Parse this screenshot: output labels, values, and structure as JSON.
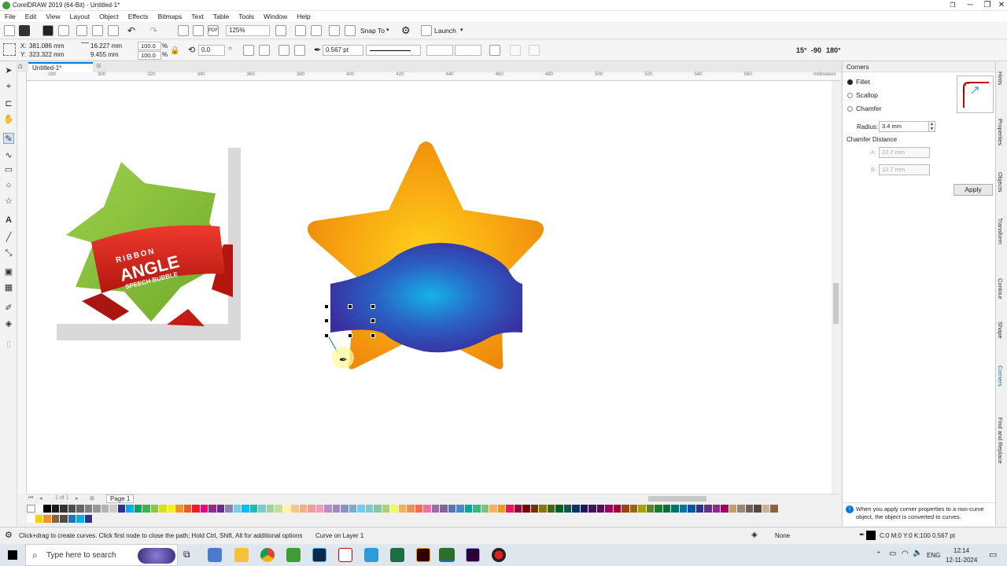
{
  "window": {
    "title": "CorelDRAW 2019 (64-Bit) - Untitled-1*",
    "btn_min": "─",
    "btn_max": "❐",
    "btn_close": "✕",
    "restore": "❐"
  },
  "menu": [
    "File",
    "Edit",
    "View",
    "Layout",
    "Object",
    "Effects",
    "Bitmaps",
    "Text",
    "Table",
    "Tools",
    "Window",
    "Help"
  ],
  "toolbar": {
    "zoom": "125%",
    "snap_to": "Snap To",
    "launch": "Launch"
  },
  "propbar": {
    "x_label": "X:",
    "x": "381.086 mm",
    "y_label": "Y:",
    "y": "323.322 mm",
    "w": "16.227 mm",
    "h": "9.455 mm",
    "sx": "100.0",
    "sy": "100.0",
    "pct": "%",
    "angle": "0.0",
    "outline": "0.567 pt",
    "deg15": "15°",
    "deg90": "-90",
    "deg180": "180°"
  },
  "doc_tab": "Untitled-1*",
  "ruler": {
    "ticks": [
      "280",
      "300",
      "320",
      "340",
      "360",
      "380",
      "400",
      "420",
      "440",
      "460",
      "480",
      "500",
      "520",
      "540",
      "560"
    ],
    "unit": "millimeters"
  },
  "page_nav": {
    "page_label": "Page 1",
    "counter": "1 of 1"
  },
  "canvas_art": {
    "ribbon_small": "RIBBON",
    "ribbon_big": "ANGLE",
    "ribbon_sub": "SPEECH BUBBLE"
  },
  "docker": {
    "title": "Corners",
    "options": [
      "Fillet",
      "Scallop",
      "Chamfer"
    ],
    "selected": "Fillet",
    "radius_label": "Radius:",
    "radius_value": "3.4 mm",
    "chamfer_title": "Chamfer Distance",
    "chamfer_a_label": "A:",
    "chamfer_a": "12.7 mm",
    "chamfer_b_label": "B:",
    "chamfer_b": "12.7 mm",
    "apply": "Apply",
    "info": "When you apply corner properties to a non-curve object, the object is converted to curves."
  },
  "docker_tabs": [
    "Hints",
    "Properties",
    "Objects",
    "Transform",
    "Contour",
    "Shape",
    "Corners",
    "Find and Replace"
  ],
  "status": {
    "hint": "Click+drag to create curves. Click first node to close the path; Hold Ctrl, Shift, Alt for additional options",
    "object": "Curve on Layer 1",
    "fill": "None",
    "outline": "C:0 M:0 Y:0 K:100  0.567 pt"
  },
  "taskbar": {
    "search": "Type here to search",
    "lang": "ENG",
    "time": "12:14",
    "date": "12-11-2024"
  },
  "colors": {
    "accent": "#0078d7",
    "star_orange": "#f39c12",
    "blue_shape": "#2d3aa8",
    "ribbon_red": "#d8261f",
    "ribbon_green": "#8cc63f",
    "palette1": [
      "#ffffff",
      "#000000",
      "#1a1a1a",
      "#333333",
      "#4d4d4d",
      "#666666",
      "#808080",
      "#999999",
      "#b3b3b3",
      "#cccccc",
      "#2e3192",
      "#00aeef",
      "#00a651",
      "#39b54a",
      "#8dc63f",
      "#d7df23",
      "#fff200",
      "#f7941d",
      "#f15a24",
      "#ed1c24",
      "#ec008c",
      "#92278f",
      "#662d91",
      "#8781bd",
      "#6dcff6",
      "#00bff3",
      "#1cbbb4",
      "#7accc8",
      "#a2d39c",
      "#c4df9b",
      "#fff799",
      "#fdc689",
      "#f9ad81",
      "#f6989d",
      "#f49ac2",
      "#bd8cbf",
      "#a187be",
      "#8393ca",
      "#7ea7d8",
      "#6ecff6",
      "#7bcdc8",
      "#82ca9c",
      "#acd373",
      "#fff568",
      "#fbaf5d",
      "#f68e56",
      "#f26c4f",
      "#f06eaa",
      "#a864a8",
      "#8560a8",
      "#5674b9",
      "#448ccb",
      "#00a99d",
      "#3cb878",
      "#7cc576",
      "#fbaf5d",
      "#f7941d",
      "#ed145b",
      "#9e0039",
      "#790000",
      "#7b2e00",
      "#827b00",
      "#406618",
      "#005e20",
      "#005952",
      "#003471",
      "#1b1464",
      "#440e62",
      "#630460",
      "#9e005d",
      "#9e0039",
      "#a0410d",
      "#a36209",
      "#aba000",
      "#598527",
      "#197b30",
      "#007236",
      "#00746b",
      "#0076a3",
      "#0054a6",
      "#2e3192",
      "#662d91",
      "#92278f",
      "#9e005d",
      "#c69c6d",
      "#998675",
      "#736357",
      "#534741",
      "#c7b299",
      "#8c6239"
    ],
    "palette2": [
      "#ffffff",
      "#fdd100",
      "#f7941d",
      "#8c6239",
      "#4d4d4d",
      "#1b75bc",
      "#00aeef",
      "#2e3192"
    ]
  }
}
